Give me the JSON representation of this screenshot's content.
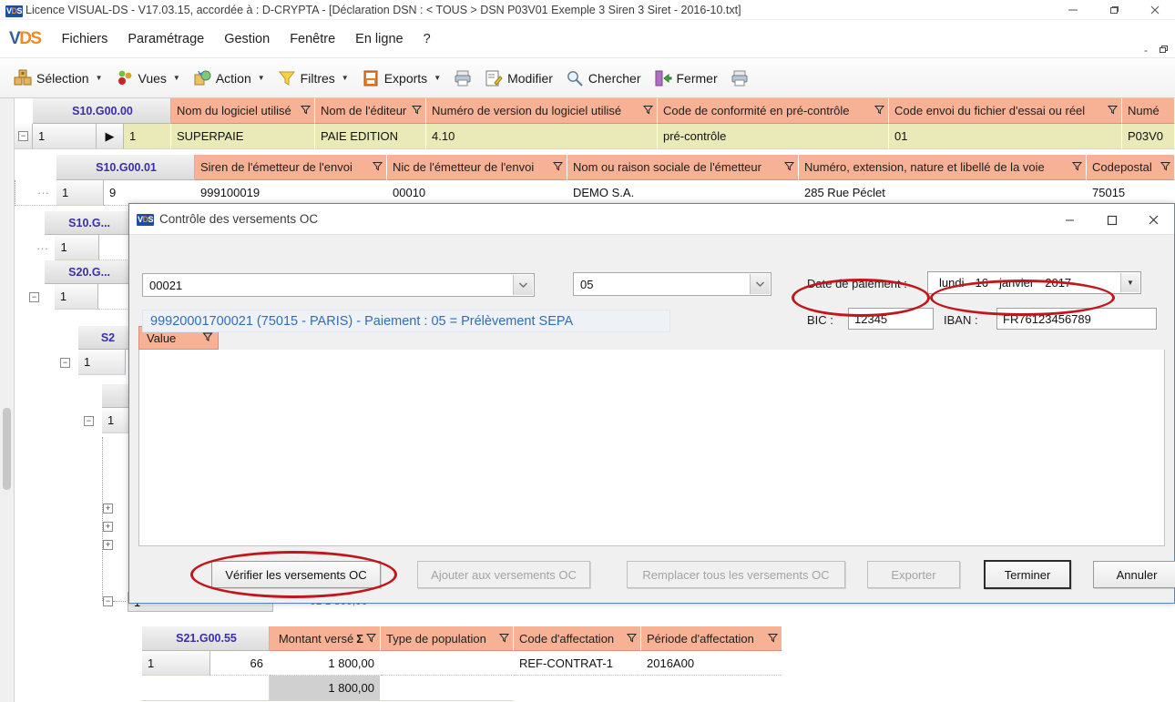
{
  "window": {
    "title": "Licence VISUAL-DS - V17.03.15, accordée à : D-CRYPTA - [Déclaration DSN :  < TOUS > DSN P03V01 Exemple 3 Siren 3 Siret - 2016-10.txt]",
    "minimize": "minimize-icon",
    "restore": "restore-icon",
    "close": "close-icon"
  },
  "menu": {
    "brand": "VDS",
    "items": [
      {
        "label": "Fichiers"
      },
      {
        "label": "Paramétrage"
      },
      {
        "label": "Gestion"
      },
      {
        "label": "Fenêtre"
      },
      {
        "label": "En ligne"
      },
      {
        "label": "?"
      }
    ],
    "mdi_minimize": "-",
    "mdi_restore": "restore-icon"
  },
  "toolbar": {
    "items": [
      {
        "label": "Sélection",
        "icon": "selection-icon",
        "caret": true
      },
      {
        "label": "Vues",
        "icon": "views-icon",
        "caret": true
      },
      {
        "label": "Action",
        "icon": "action-icon",
        "caret": true
      },
      {
        "label": "Filtres",
        "icon": "filter-icon",
        "caret": true
      },
      {
        "label": "Exports",
        "icon": "export-icon",
        "caret": true
      },
      {
        "label": "",
        "icon": "print-icon",
        "caret": false
      },
      {
        "label": "Modifier",
        "icon": "edit-icon",
        "caret": false
      },
      {
        "label": "Chercher",
        "icon": "search-icon",
        "caret": false
      },
      {
        "label": "Fermer",
        "icon": "close-door-icon",
        "caret": false
      },
      {
        "label": "",
        "icon": "print2-icon",
        "caret": false
      }
    ]
  },
  "grids": [
    {
      "code": "S10.G00.00",
      "columns": [
        "Nom du logiciel utilisé",
        "Nom de l'éditeur",
        "Numéro de version du logiciel utilisé",
        "Code de conformité en pré-contrôle",
        "Code envoi du fichier d'essai ou réel",
        "Numé"
      ],
      "row_index": "1",
      "row_num": "1",
      "values": [
        "SUPERPAIE",
        "PAIE EDITION",
        "4.10",
        "pré-contrôle",
        "01",
        "P03V0"
      ]
    },
    {
      "code": "S10.G00.01",
      "columns": [
        "Siren de l'émetteur de l'envoi",
        "Nic de l'émetteur de l'envoi",
        "Nom ou raison sociale de l'émetteur",
        "Numéro, extension, nature et libellé de la voie",
        "Codepostal"
      ],
      "row_index": "1",
      "row_num": "9",
      "values": [
        "999100019",
        "00010",
        "DEMO S.A.",
        "285 Rue Péclet",
        "75015"
      ]
    }
  ],
  "tree_codes": {
    "s10_g00_02": "S10.G...",
    "s20_g00": "S20.G...",
    "s21": "S2"
  },
  "dialog": {
    "title": "Contrôle des versements OC",
    "icon": "vds-icon",
    "minimize": "minimize-icon",
    "maximize": "maximize-icon",
    "close": "close-icon",
    "combo_oc": {
      "value": "00021",
      "arrow": "chevron-down-icon"
    },
    "combo_mode": {
      "value": "05",
      "arrow": "chevron-down-icon"
    },
    "info_line": "99920001700021 (75015 - PARIS)  - Paiement :  05 = Prélèvement SEPA",
    "date_label": "Date de paiement :",
    "date": {
      "weekday": "lundi",
      "day": "16",
      "month": "janvier",
      "year": "2017",
      "arrow": "dropdown-icon"
    },
    "bic_label": "BIC :",
    "bic_value": "12345",
    "iban_label": "IBAN :",
    "iban_value": "FR76123456789",
    "list_header": "Value",
    "list_filter_icon": "funnel-icon",
    "buttons": [
      {
        "label": "Vérifier les versements OC",
        "state": "enabled",
        "highlighted": true
      },
      {
        "label": "Ajouter aux versements OC",
        "state": "disabled",
        "highlighted": false
      },
      {
        "label": "Remplacer tous les versements OC",
        "state": "disabled",
        "highlighted": false
      },
      {
        "label": "Exporter",
        "state": "disabled",
        "highlighted": false
      },
      {
        "label": "Terminer",
        "state": "default",
        "highlighted": false
      },
      {
        "label": "Annuler",
        "state": "enabled",
        "highlighted": false
      }
    ]
  },
  "bottom_grid": {
    "code": "S21.G00.55",
    "columns": [
      {
        "label": "Montant versé",
        "sum": true
      },
      {
        "label": "Type de population",
        "sum": false
      },
      {
        "label": "Code d'affectation",
        "sum": false
      },
      {
        "label": "Période d'affectation",
        "sum": false
      }
    ],
    "rows": [
      {
        "index": "1",
        "num": "66",
        "cells": [
          "1 800,00",
          "",
          "REF-CONTRAT-1",
          "2016A00"
        ]
      }
    ],
    "total": {
      "label": "",
      "value": "1 800,00"
    }
  },
  "annotations": {
    "ellipse_color": "#c0171c",
    "count": 3
  }
}
